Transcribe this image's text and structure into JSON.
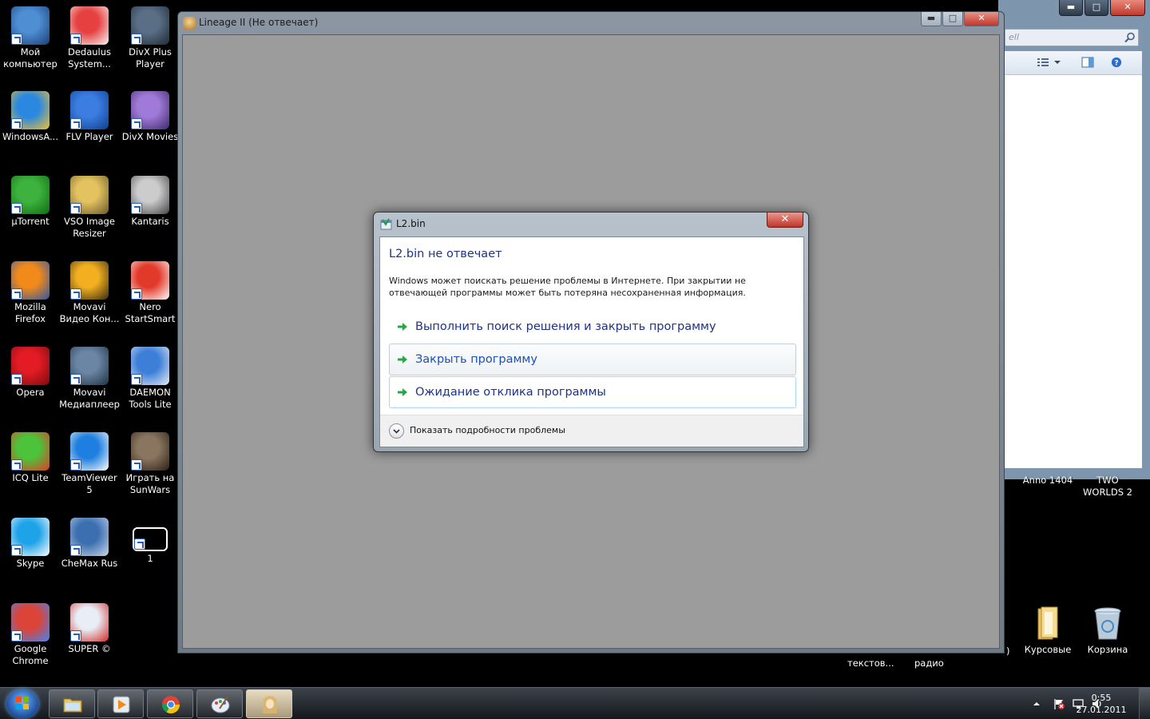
{
  "desktop": {
    "icons": [
      {
        "label": "Мой\nкомпьютер",
        "icon": "computer-icon"
      },
      {
        "label": "Dedaulus\nSystem...",
        "icon": "dedaulus-icon"
      },
      {
        "label": "DivX Plus\nPlayer",
        "icon": "divx-player-icon"
      },
      {
        "label": "WindowsA...",
        "icon": "windowsa-icon"
      },
      {
        "label": "FLV Player",
        "icon": "flv-player-icon"
      },
      {
        "label": "DivX Movies",
        "icon": "divx-movies-icon"
      },
      {
        "label": "µTorrent",
        "icon": "utorrent-icon"
      },
      {
        "label": "VSO Image\nResizer",
        "icon": "vso-resizer-icon"
      },
      {
        "label": "Kantaris",
        "icon": "kantaris-icon"
      },
      {
        "label": "Mozilla\nFirefox",
        "icon": "firefox-icon"
      },
      {
        "label": "Movavi\nВидео Кон...",
        "icon": "movavi-video-icon"
      },
      {
        "label": "Nero\nStartSmart",
        "icon": "nero-icon"
      },
      {
        "label": "Opera",
        "icon": "opera-icon"
      },
      {
        "label": "Movavi\nМедиаплеер",
        "icon": "movavi-player-icon"
      },
      {
        "label": "DAEMON\nTools Lite",
        "icon": "daemon-tools-icon"
      },
      {
        "label": "ICQ Lite",
        "icon": "icq-icon"
      },
      {
        "label": "TeamViewer\n5",
        "icon": "teamviewer-icon"
      },
      {
        "label": "Играть на\nSunWars",
        "icon": "lineage-sunwars-icon"
      },
      {
        "label": "Skype",
        "icon": "skype-icon"
      },
      {
        "label": "CheMax Rus",
        "icon": "chemax-icon"
      },
      {
        "label": "1",
        "icon": "video-file-icon"
      },
      {
        "label": "Google\nChrome",
        "icon": "chrome-icon"
      },
      {
        "label": "SUPER ©",
        "icon": "super-icon"
      }
    ],
    "right_icons": [
      {
        "label": "Anno 1404"
      },
      {
        "label": "TWO\nWORLDS 2"
      },
      {
        "label": "Курсовые",
        "icon": "folder-icon"
      },
      {
        "label": "Корзина",
        "icon": "recycle-bin-icon"
      }
    ],
    "partial_labels": [
      "текстов...",
      "радио",
      ")"
    ]
  },
  "background_window": {
    "search_placeholder": "ell",
    "controls": {
      "minimize": "▬",
      "maximize": "□",
      "close": "✕"
    }
  },
  "lineage_window": {
    "title": "Lineage II  (Не отвечает)",
    "controls": {
      "minimize": "▬",
      "maximize": "□",
      "close": "✕"
    }
  },
  "dialog": {
    "title": "L2.bin",
    "close": "✕",
    "heading": "L2.bin не отвечает",
    "description": "Windows может поискать решение проблемы в Интернете. При закрытии не отвечающей программы может быть потеряна несохраненная информация.",
    "options": [
      {
        "label": "Выполнить поиск решения и закрыть программу",
        "state": "normal"
      },
      {
        "label": "Закрыть программу",
        "state": "hover"
      },
      {
        "label": "Ожидание отклика программы",
        "state": "focus"
      }
    ],
    "details_label": "Показать подробности проблемы"
  },
  "taskbar": {
    "pinned": [
      {
        "name": "explorer",
        "icon": "folder-icon"
      },
      {
        "name": "media-player",
        "icon": "media-player-icon"
      },
      {
        "name": "chrome",
        "icon": "chrome-icon"
      },
      {
        "name": "paint",
        "icon": "paint-icon"
      },
      {
        "name": "lineage",
        "icon": "lineage-icon",
        "active": true
      }
    ],
    "clock": {
      "time": "0:55",
      "date": "27.01.2011"
    }
  },
  "colors": {
    "accent_blue": "#1e3287",
    "link_hover": "#1c50b8",
    "close_red": "#c2352a",
    "window_client": "#9c9c9c"
  }
}
